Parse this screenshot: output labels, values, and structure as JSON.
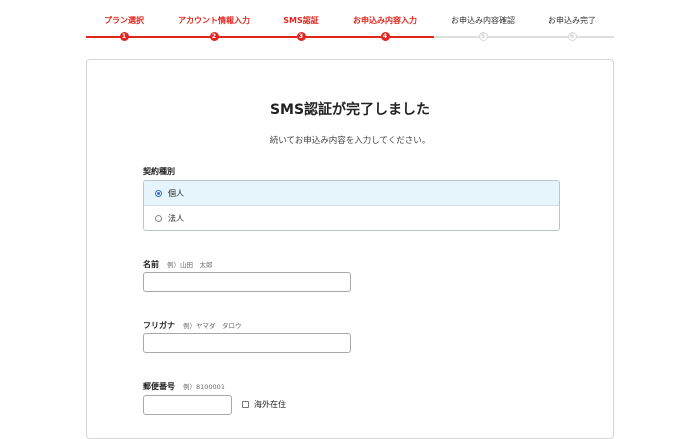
{
  "stepper": {
    "steps": [
      {
        "label": "プラン選択",
        "num": "1",
        "state": "done"
      },
      {
        "label": "アカウント情報入力",
        "num": "2",
        "state": "done"
      },
      {
        "label": "SMS認証",
        "num": "3",
        "state": "done"
      },
      {
        "label": "お申込み内容入力",
        "num": "4",
        "state": "done"
      },
      {
        "label": "お申込み内容確認",
        "num": "5",
        "state": "todo"
      },
      {
        "label": "お申込み完了",
        "num": "6",
        "state": "todo"
      }
    ],
    "accent_color": "#e0261e"
  },
  "card": {
    "title": "SMS認証が完了しました",
    "subtitle": "続いてお申込み内容を入力してください。"
  },
  "contract_type": {
    "label": "契約種別",
    "options": [
      {
        "label": "個人",
        "selected": true
      },
      {
        "label": "法人",
        "selected": false
      }
    ]
  },
  "name": {
    "label": "名前",
    "hint": "例）山田　太郎",
    "value": ""
  },
  "furigana": {
    "label": "フリガナ",
    "hint": "例）ヤマダ　タロウ",
    "value": ""
  },
  "postal": {
    "label": "郵便番号",
    "hint": "例）8100001",
    "value": "",
    "overseas_label": "海外在住"
  }
}
